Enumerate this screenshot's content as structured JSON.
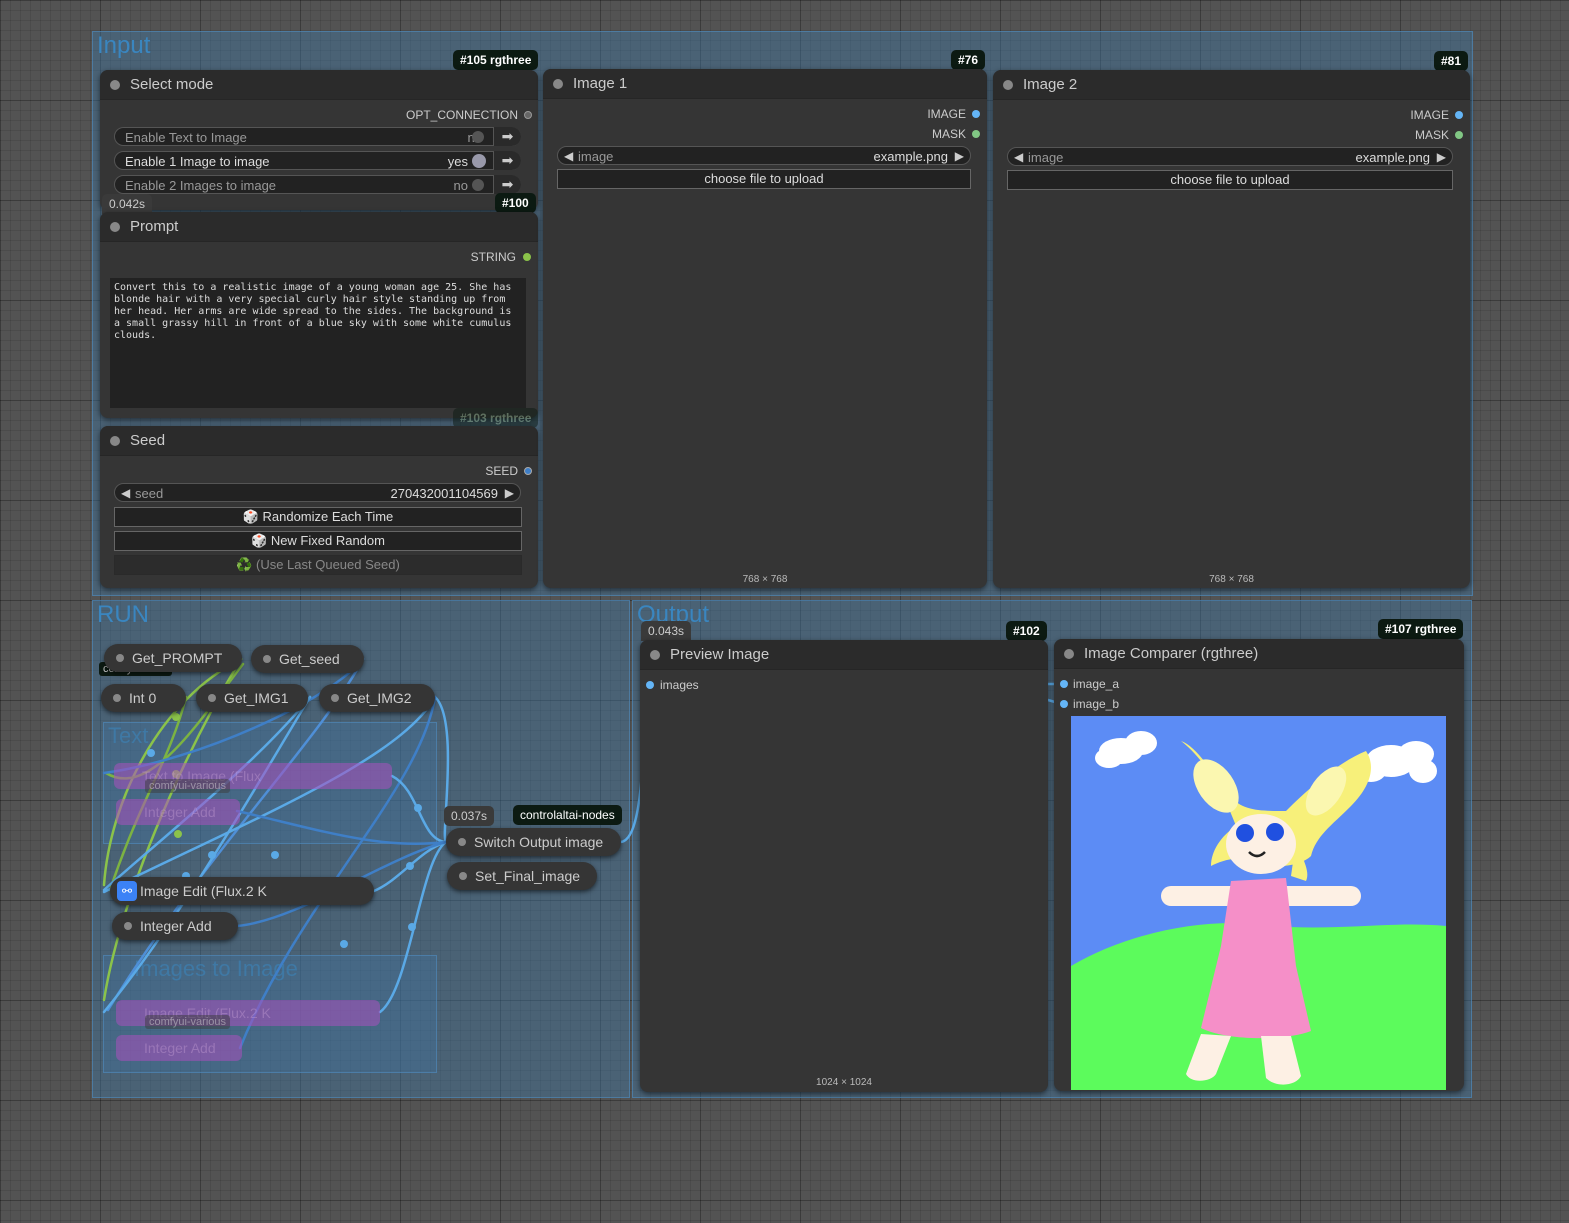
{
  "groups": {
    "input": "Input",
    "run": "RUN",
    "output": "Output",
    "text_to_image": "Text",
    "images_to_image": "Images to Image"
  },
  "select_mode": {
    "title": "Select mode",
    "badge": "#105 rgthree",
    "output": "OPT_CONNECTION",
    "toggles": [
      {
        "label": "Enable Text to Image",
        "value": "no"
      },
      {
        "label": "Enable 1 Image to image",
        "value": "yes"
      },
      {
        "label": "Enable 2 Images to image",
        "value": "no"
      }
    ],
    "time": "0.042s"
  },
  "prompt": {
    "title": "Prompt",
    "badge": "#100",
    "output": "STRING",
    "text": "Convert this to a realistic image of a young woman age 25. She has blonde hair with a very special curly hair style standing up from her head. Her arms are wide spread to the sides. The background is a small grassy hill in front of a blue sky with some white cumulus clouds."
  },
  "seed": {
    "title": "Seed",
    "badge": "#103 rgthree",
    "output": "SEED",
    "widget_label": "seed",
    "widget_value": "270432001104569",
    "btn_randomize": "🎲 Randomize Each Time",
    "btn_fixed": "🎲 New Fixed Random",
    "btn_last": "♻️ (Use Last Queued Seed)"
  },
  "image1": {
    "title": "Image 1",
    "badge": "#76",
    "out_image": "IMAGE",
    "out_mask": "MASK",
    "combo_label": "image",
    "combo_value": "example.png",
    "upload": "choose file to upload",
    "size": "768 × 768"
  },
  "image2": {
    "title": "Image 2",
    "badge": "#81",
    "out_image": "IMAGE",
    "out_mask": "MASK",
    "combo_label": "image",
    "combo_value": "example.png",
    "upload": "choose file to upload",
    "size": "768 × 768"
  },
  "run": {
    "get_prompt": "Get_PROMPT",
    "get_seed": "Get_seed",
    "int0": "Int 0",
    "get_img1": "Get_IMG1",
    "get_img2": "Get_IMG2",
    "image_edit": "Image Edit (Flux.2 K",
    "integer_add": "Integer Add",
    "switch_output": "Switch Output image",
    "switch_time": "0.037s",
    "switch_badge": "controlaltai-nodes",
    "set_final": "Set_Final_image",
    "ghost_text_to_image": "Text to Image (Flux",
    "ghost_integer_add": "Integer Add",
    "ghost_image_edit": "Image Edit (Flux.2 K",
    "ghost_integer_add2": "Integer Add",
    "tag_various1": "comfyui-various",
    "tag_various2": "comfyui-various",
    "tag_literals": "comfy-literals"
  },
  "preview": {
    "title": "Preview Image",
    "badge": "#102",
    "time": "0.043s",
    "input": "images",
    "size": "1024 × 1024"
  },
  "comparer": {
    "title": "Image Comparer (rgthree)",
    "badge": "#107 rgthree",
    "input_a": "image_a",
    "input_b": "image_b"
  },
  "colors": {
    "socket_image": "#64b5f6",
    "socket_mask": "#81c784",
    "socket_string": "#8bc34a",
    "socket_seed": "#3f7fc7",
    "link_blue": "#5aa9e6",
    "link_green": "#8bc34a"
  }
}
